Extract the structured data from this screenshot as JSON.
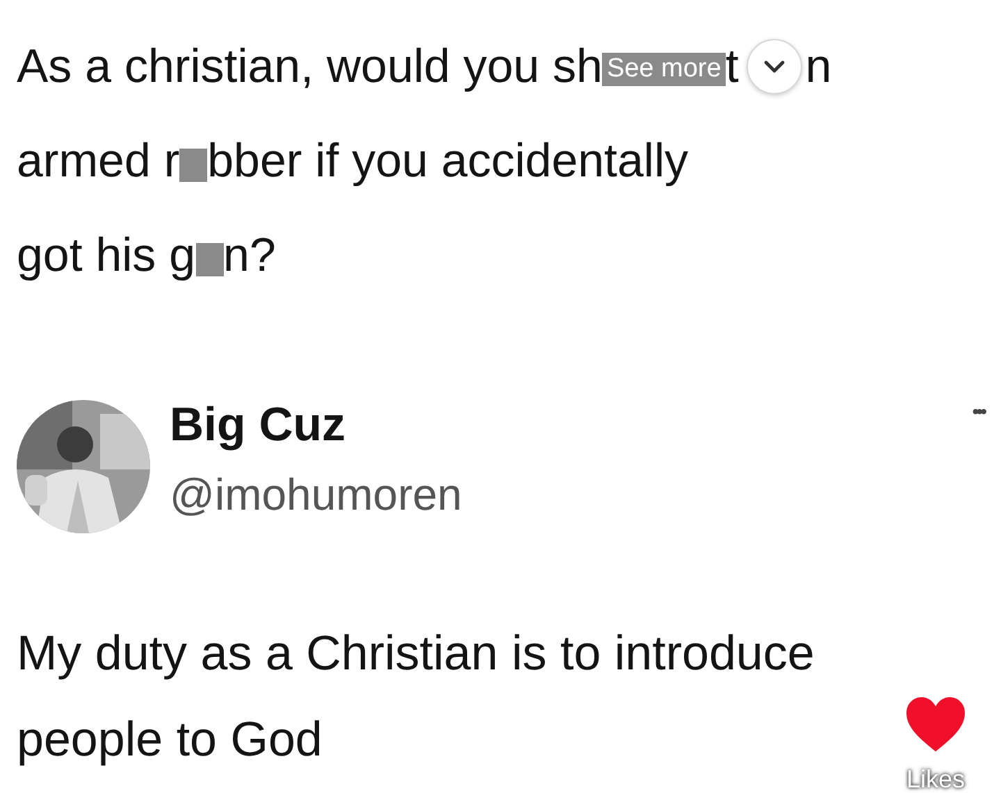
{
  "question": {
    "lines": [
      [
        {
          "kind": "text",
          "text": "As a christian, would you sh"
        },
        {
          "kind": "censor",
          "overlay": "See more"
        },
        {
          "kind": "text",
          "text": "t"
        },
        {
          "kind": "expand"
        },
        {
          "kind": "text",
          "text": "n"
        }
      ],
      [
        {
          "kind": "text",
          "text": "armed r"
        },
        {
          "kind": "censor"
        },
        {
          "kind": "text",
          "text": "bber if you accidentally"
        }
      ],
      [
        {
          "kind": "text",
          "text": "got his g"
        },
        {
          "kind": "censor"
        },
        {
          "kind": "text",
          "text": "n?"
        }
      ]
    ]
  },
  "reply": {
    "author": {
      "name": "Big Cuz",
      "handle": "@imohumoren"
    },
    "more": "•••",
    "text": "My duty as a Christian is to introduce people to God"
  },
  "likes": {
    "label": "Likes"
  }
}
